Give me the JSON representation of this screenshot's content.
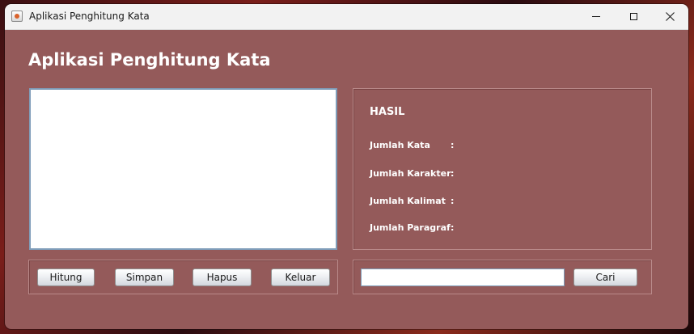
{
  "window": {
    "title": "Aplikasi Penghitung Kata"
  },
  "main": {
    "heading": "Aplikasi Penghitung Kata",
    "text_area_value": ""
  },
  "result": {
    "title": "HASIL",
    "stats": [
      {
        "label": "Jumlah Kata",
        "colon": ":",
        "value": ""
      },
      {
        "label": "Jumlah Karakter",
        "colon": ":",
        "value": ""
      },
      {
        "label": "Jumlah Kalimat",
        "colon": ":",
        "value": ""
      },
      {
        "label": "Jumlah Paragraf",
        "colon": ":",
        "value": ""
      }
    ]
  },
  "buttons": {
    "hitung": "Hitung",
    "simpan": "Simpan",
    "hapus": "Hapus",
    "keluar": "Keluar"
  },
  "search": {
    "input_value": "",
    "button_label": "Cari"
  },
  "colors": {
    "window_background": "#945a5a",
    "titlebar_background": "#f2f2f2",
    "text_light": "#ffffff"
  },
  "icons": {
    "app": "java-app-icon",
    "minimize": "minimize-icon",
    "maximize": "maximize-icon",
    "close": "close-icon"
  }
}
